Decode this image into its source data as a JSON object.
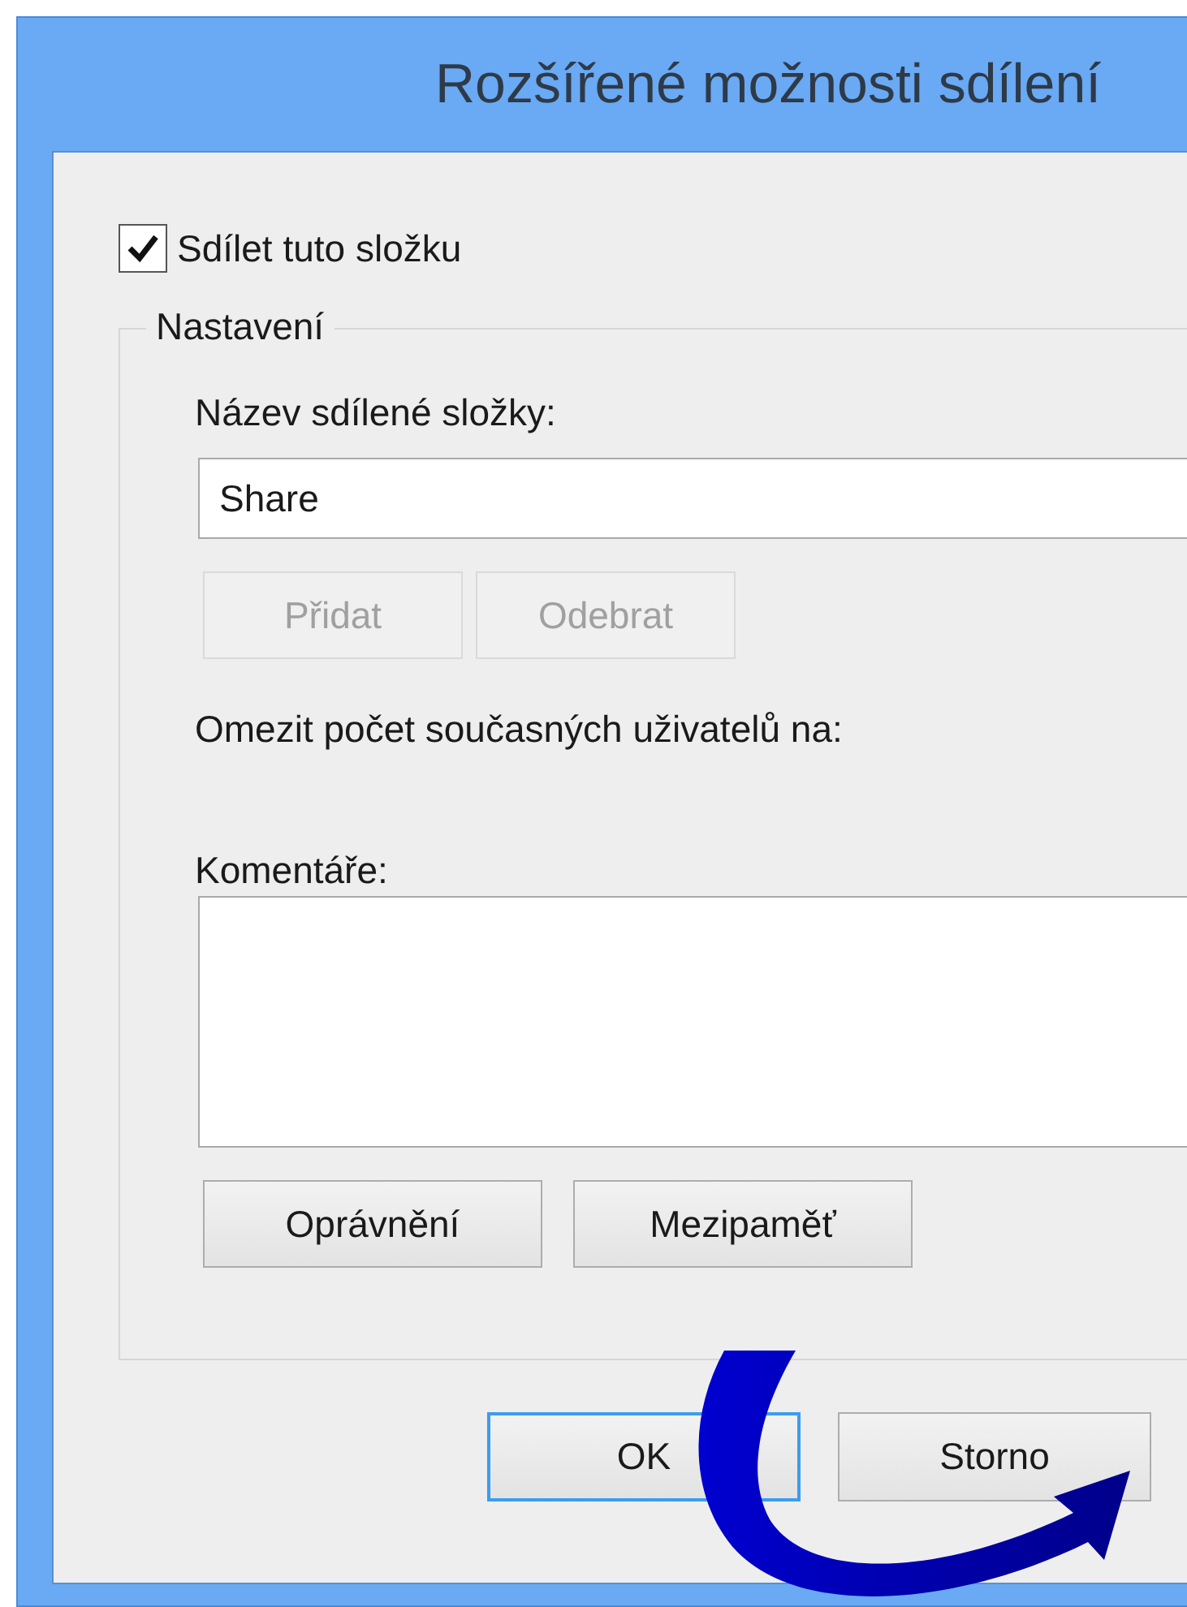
{
  "window": {
    "title": "Rozšířené možnosti sdílení"
  },
  "share_checkbox": {
    "label": "Sdílet tuto složku",
    "checked": true
  },
  "settings_group": {
    "title": "Nastavení",
    "share_name": {
      "label": "Název sdílené složky:",
      "value": "Share"
    },
    "name_buttons": [
      {
        "label": "Přidat",
        "disabled": true
      },
      {
        "label": "Odebrat",
        "disabled": true
      }
    ],
    "user_limit": {
      "label": "Omezit počet současných uživatelů na:"
    },
    "comments": {
      "label": "Komentáře:"
    },
    "buttons": [
      {
        "label": "Oprávnění",
        "disabled": false
      },
      {
        "label": "Mezipaměť",
        "disabled": false
      }
    ]
  },
  "dialog_buttons": [
    {
      "label": "OK",
      "default": true
    },
    {
      "label": "Storno",
      "default": false
    }
  ]
}
